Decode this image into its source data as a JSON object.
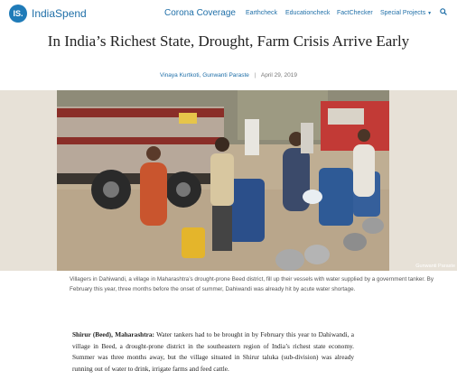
{
  "brand": {
    "badge": "IS.",
    "name": "IndiaSpend"
  },
  "nav": {
    "corona": "Corona Coverage",
    "items": [
      "Earthcheck",
      "Educationcheck",
      "FactChecker",
      "Special Projects"
    ]
  },
  "article": {
    "title": "In India’s Richest State, Drought, Farm Crisis Arrive Early",
    "authors": "Vinaya Kurtkoti, Gunwanti Paraste",
    "date": "April 29, 2019",
    "photo_credit": "Gunwanti Paraste",
    "caption": "Villagers in Dahiwandi, a village in Maharashtra’s drought-prone Beed district, fill up their vessels with water supplied by a government tanker. By February this year, three months before the onset of summer, Dahiwandi was already hit by acute water shortage.",
    "dateline": "Shirur (Beed), Maharashtra:",
    "body": " Water tankers had to be brought in by February this year to Dahiwandi, a village in Beed, a drought-prone district in the southeastern region of India’s richest state economy. Summer was three months away, but the village situated in Shirur taluka (sub-division) was already running out of water to drink, irrigate farms and feed cattle."
  },
  "colors": {
    "brand": "#1f7bb8",
    "link": "#1f6fa8"
  },
  "icons": [
    "search-icon",
    "chevron-down-icon"
  ]
}
